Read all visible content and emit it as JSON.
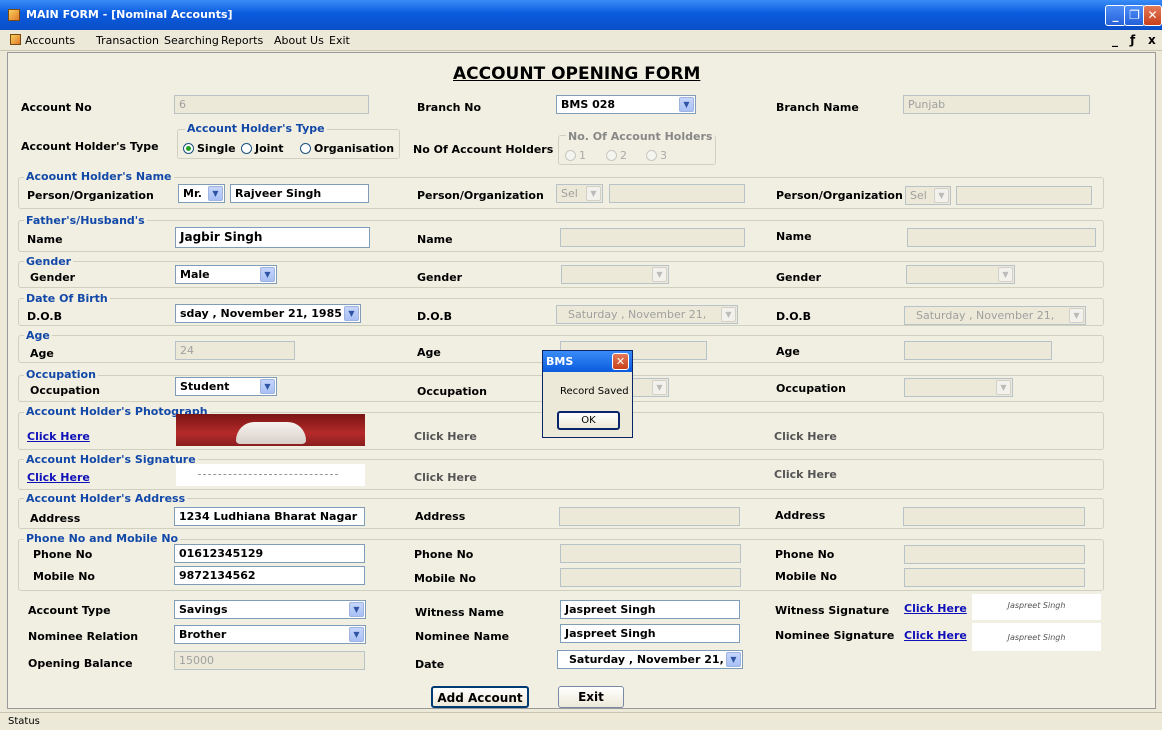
{
  "window": {
    "title": "MAIN FORM - [Nominal Accounts]"
  },
  "menu": {
    "items": [
      "Accounts",
      "Transaction",
      "Searching",
      "Reports",
      "About Us",
      "Exit"
    ]
  },
  "form": {
    "heading": "ACCOUNT OPENING FORM",
    "account_no": {
      "label": "Account No",
      "value": "6"
    },
    "branch_no": {
      "label": "Branch No",
      "value": "BMS 028"
    },
    "branch_name": {
      "label": "Branch Name",
      "value": "Punjab"
    },
    "holder_type": {
      "label": "Account Holder's Type",
      "group": "Account Holder's Type",
      "options": [
        "Single",
        "Joint",
        "Organisation"
      ],
      "selected": "Single"
    },
    "num_holders": {
      "label": "No Of Account Holders",
      "group": "No. Of Account Holders",
      "options": [
        "1",
        "2",
        "3"
      ],
      "selected": "1"
    },
    "name_group": "Acoount Holder's Name",
    "person_label": "Person/Organization",
    "title1": "Mr.",
    "name1": "Rajveer Singh",
    "title_placeholder": "Sel",
    "father_group": "Father's/Husband's",
    "name_label": "Name",
    "father1": "Jagbir Singh",
    "gender_group": "Gender",
    "gender_label": "Gender",
    "gender1": "Male",
    "dob_group": "Date Of Birth",
    "dob_label": "D.O.B",
    "dob1": "sday , November 21, 1985",
    "dob2": "Saturday , November 21,",
    "dob3": "Saturday , November 21,",
    "age_group": "Age",
    "age_label": "Age",
    "age1": "24",
    "occ_group": "Occupation",
    "occ_label": "Occupation",
    "occ1": "Student",
    "photo_group": "Account Holder's Photograph",
    "click_here": "Click Here",
    "sig_group": "Account Holder's Signature",
    "address_group": "Account Holder's Address",
    "address_label": "Address",
    "address1": "1234 Ludhiana Bharat Nagar",
    "phone_group": "Phone No and Mobile No",
    "phone_label": "Phone No",
    "phone1": "01612345129",
    "mobile_label": "Mobile No",
    "mobile1": "9872134562",
    "account_type": {
      "label": "Account Type",
      "value": "Savings"
    },
    "nominee_relation": {
      "label": "Nominee Relation",
      "value": "Brother"
    },
    "opening_balance": {
      "label": "Opening Balance",
      "value": "15000"
    },
    "witness_name": {
      "label": "Witness Name",
      "value": "Jaspreet Singh"
    },
    "nominee_name": {
      "label": "Nominee Name",
      "value": "Jaspreet Singh"
    },
    "date": {
      "label": "Date",
      "value": "Saturday , November 21,"
    },
    "witness_signature": "Witness Signature",
    "nominee_signature": "Nominee Signature",
    "signature_text": "Jaspreet Singh",
    "add_button": "Add Account",
    "exit_button": "Exit"
  },
  "dialog": {
    "title": "BMS",
    "message": "Record Saved",
    "ok": "OK"
  },
  "status": "Status"
}
